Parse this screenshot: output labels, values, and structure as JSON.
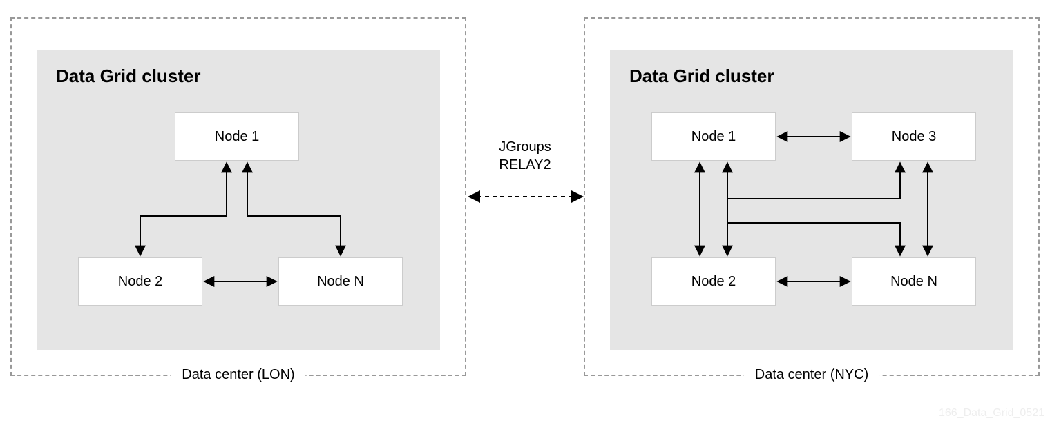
{
  "relay": {
    "line1": "JGroups",
    "line2": "RELAY2"
  },
  "watermark": "166_Data_Grid_0521",
  "left_dc": {
    "label": "Data center (LON)",
    "cluster_title": "Data Grid cluster",
    "nodes": {
      "n1": "Node 1",
      "n2": "Node 2",
      "nN": "Node N"
    }
  },
  "right_dc": {
    "label": "Data center (NYC)",
    "cluster_title": "Data Grid cluster",
    "nodes": {
      "n1": "Node 1",
      "n2": "Node 2",
      "n3": "Node 3",
      "nN": "Node N"
    }
  }
}
